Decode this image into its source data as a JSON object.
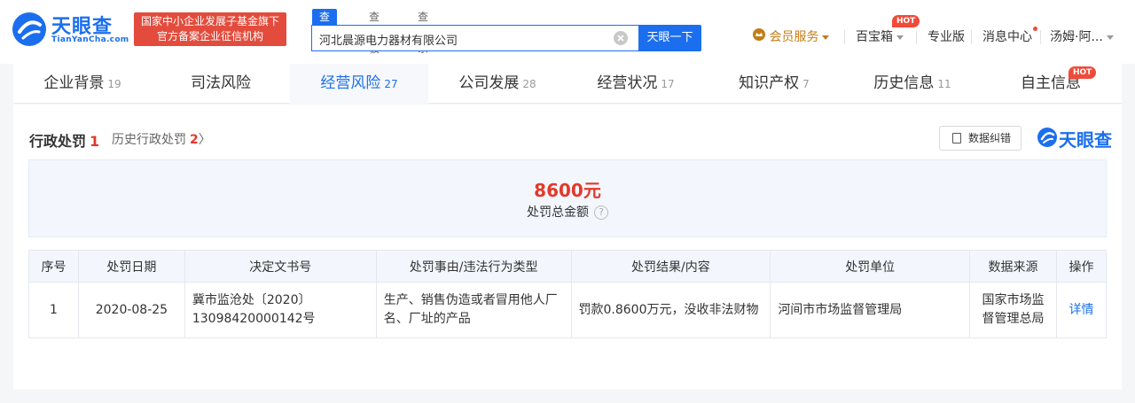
{
  "header": {
    "logo_text": "天眼查",
    "logo_sub": "TianYanCha.com",
    "gov_badge_line1": "国家中小企业发展子基金旗下",
    "gov_badge_line2": "官方备案企业征信机构",
    "search_tabs": [
      "查公司",
      "查老板",
      "查关系"
    ],
    "search_value": "河北晨源电力器材有限公司",
    "search_button": "天眼一下",
    "nav": {
      "member": "会员服务",
      "baibao": "百宝箱",
      "hot": "HOT",
      "pro": "专业版",
      "messages": "消息中心",
      "user": "汤姆·阿..."
    }
  },
  "tabs": [
    {
      "label": "企业背景",
      "count": "19"
    },
    {
      "label": "司法风险",
      "count": ""
    },
    {
      "label": "经营风险",
      "count": "27"
    },
    {
      "label": "公司发展",
      "count": "28"
    },
    {
      "label": "经营状况",
      "count": "17"
    },
    {
      "label": "知识产权",
      "count": "7"
    },
    {
      "label": "历史信息",
      "count": "11"
    },
    {
      "label": "自主信息",
      "count": ""
    }
  ],
  "tab_hot": "HOT",
  "section": {
    "title": "行政处罚",
    "count": "1",
    "history_label": "历史行政处罚",
    "history_count": "2",
    "history_arrow": "〉",
    "feedback": "数据纠错",
    "brand": "天眼查"
  },
  "summary": {
    "amount": "8600元",
    "label": "处罚总金额",
    "help": "?"
  },
  "table": {
    "headers": [
      "序号",
      "处罚日期",
      "决定文书号",
      "处罚事由/违法行为类型",
      "处罚结果/内容",
      "处罚单位",
      "数据来源",
      "操作"
    ],
    "rows": [
      {
        "no": "1",
        "date": "2020-08-25",
        "doc_line1": "冀市监沧处〔2020〕",
        "doc_line2": "13098420000142号",
        "reason": "生产、销售伪造或者冒用他人厂名、厂址的产品",
        "result": "罚款0.8600万元，没收非法财物",
        "unit": "河间市市场监督管理局",
        "source": "国家市场监督管理总局",
        "action": "详情"
      }
    ]
  },
  "colors": {
    "primary": "#1b6fee",
    "red": "#e3392b",
    "gold": "#c27c17"
  }
}
